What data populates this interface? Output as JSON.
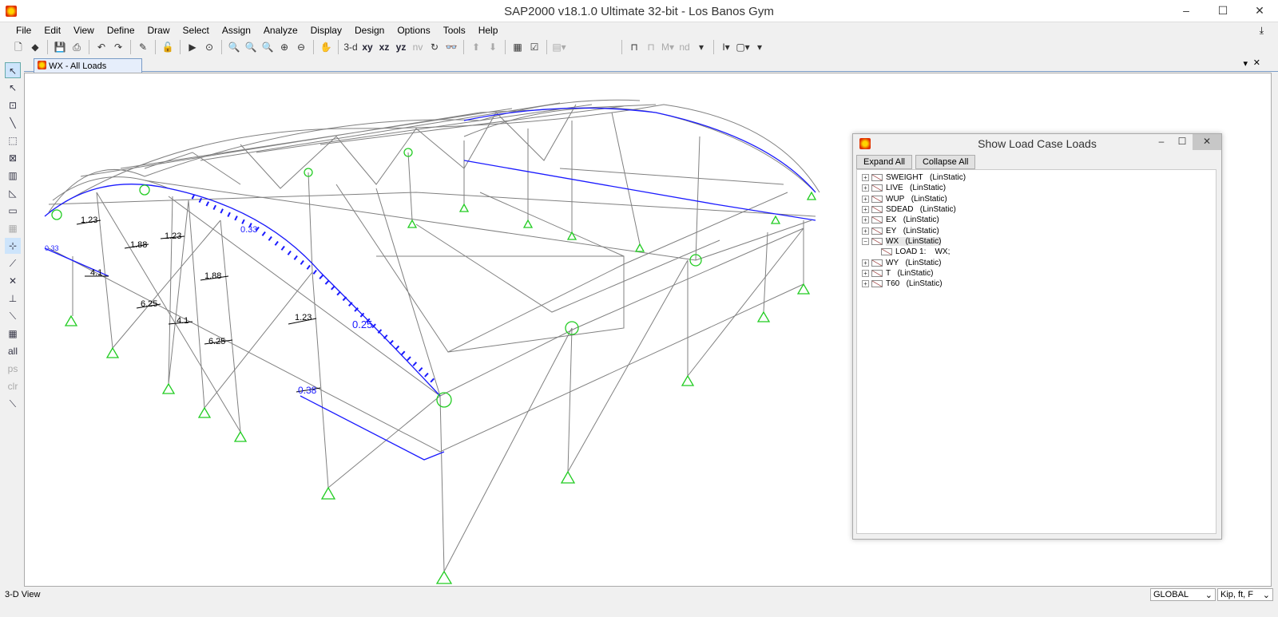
{
  "window": {
    "title": "SAP2000 v18.1.0 Ultimate 32-bit - Los Banos Gym"
  },
  "menu": [
    "File",
    "Edit",
    "View",
    "Define",
    "Draw",
    "Select",
    "Assign",
    "Analyze",
    "Display",
    "Design",
    "Options",
    "Tools",
    "Help"
  ],
  "toolbar": {
    "view_3d": "3-d",
    "view_xy": "xy",
    "view_xz": "xz",
    "view_yz": "yz",
    "view_nv": "nv",
    "nd": "nd"
  },
  "tab": {
    "label": "WX - All Loads"
  },
  "viewport": {
    "load_labels": {
      "a": "1.23",
      "b": "1.88",
      "c": "4.1",
      "d": "6.25",
      "e": "0.33",
      "f": "0.25",
      "g": "0.38"
    }
  },
  "panel": {
    "title": "Show Load Case Loads",
    "expand_all": "Expand All",
    "collapse_all": "Collapse All",
    "cases": [
      {
        "name": "SWEIGHT",
        "type": "(LinStatic)"
      },
      {
        "name": "LIVE",
        "type": "(LinStatic)"
      },
      {
        "name": "WUP",
        "type": "(LinStatic)"
      },
      {
        "name": "SDEAD",
        "type": "(LinStatic)"
      },
      {
        "name": "EX",
        "type": "(LinStatic)"
      },
      {
        "name": "EY",
        "type": "(LinStatic)"
      },
      {
        "name": "WX",
        "type": "(LinStatic)"
      },
      {
        "name": "WY",
        "type": "(LinStatic)"
      },
      {
        "name": "T",
        "type": "(LinStatic)"
      },
      {
        "name": "T60",
        "type": "(LinStatic)"
      }
    ],
    "wx_child": {
      "name": "LOAD 1:",
      "value": "WX;"
    }
  },
  "status": {
    "view": "3-D View",
    "coord_system": "GLOBAL",
    "units": "Kip, ft, F"
  }
}
